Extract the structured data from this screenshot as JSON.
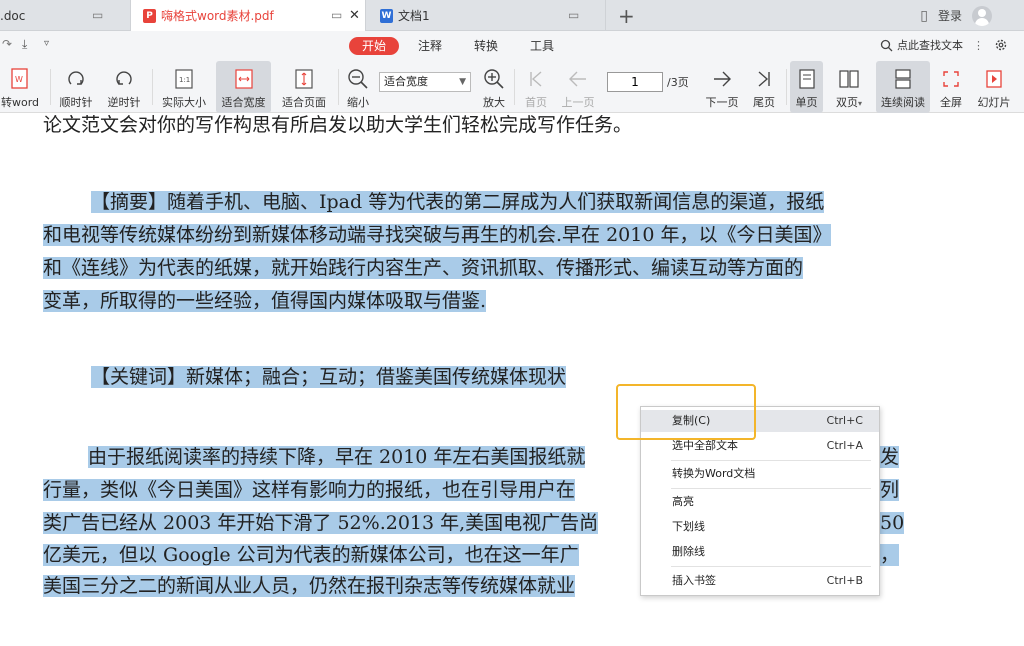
{
  "tabs": [
    {
      "label": ".doc"
    },
    {
      "label": "嗨格式word素材.pdf"
    },
    {
      "label": "文档1"
    }
  ],
  "topbar": {
    "login": "登录"
  },
  "menu": {
    "start": "开始",
    "annotate": "注释",
    "convert": "转换",
    "tools": "工具",
    "find": "点此查找文本"
  },
  "toolbar": {
    "to_word": "转word",
    "rotate_cw": "顺时针",
    "rotate_ccw": "逆时针",
    "actual_size": "实际大小",
    "fit_width": "适合宽度",
    "fit_page": "适合页面",
    "zoom_out": "缩小",
    "zoom_value": "适合宽度",
    "zoom_in": "放大",
    "first_page": "首页",
    "prev_page": "上一页",
    "page_current": "1",
    "page_total": "/3页",
    "next_page": "下一页",
    "last_page": "尾页",
    "single_page": "单页",
    "double_page": "双页",
    "continuous": "连续阅读",
    "fullscreen": "全屏",
    "slideshow": "幻灯片"
  },
  "document": {
    "line0": "论文范文会对你的写作构思有所启发以助大学生们轻松完成写作任务。",
    "abstract": [
      "【摘要】随着手机、电脑、Ipad 等为代表的第二屏成为人们获取新闻信息的渠道，报纸",
      "和电视等传统媒体纷纷到新媒体移动端寻找突破与再生的机会.早在 2010 年，以《今日美国》",
      "和《连线》为代表的纸媒，就开始践行内容生产、资讯抓取、传播形式、编读互动等方面的",
      "变革，所取得的一些经验，值得国内媒体吸取与借鉴."
    ],
    "keywords": "【关键词】新媒体；融合；互动；借鉴美国传统媒体现状",
    "body": [
      "由于报纸阅读率的持续下降，早在 2010 年左右美国报纸就",
      "行量，类似《今日美国》这样有影响力的报纸，也在引导用户在",
      "类广告已经从 2003 年开始下滑了 52%.2013 年,美国电视广告尚",
      "亿美元，但以 Google 公司为代表的新媒体公司，也在这一年广",
      "美国三分之二的新闻从业人员，仍然在报刊杂志等传统媒体就业"
    ],
    "body_right": [
      "发",
      "列",
      "50",
      "，"
    ]
  },
  "context_menu": {
    "copy": "复制(C)",
    "copy_shortcut": "Ctrl+C",
    "select_all": "选中全部文本",
    "select_all_shortcut": "Ctrl+A",
    "to_word": "转换为Word文档",
    "highlight": "高亮",
    "underline": "下划线",
    "strikethrough": "删除线",
    "bookmark": "插入书签",
    "bookmark_shortcut": "Ctrl+B"
  },
  "colors": {
    "accent": "#e8433b",
    "selection": "#a9cbe8",
    "focus": "#f3b52a"
  }
}
